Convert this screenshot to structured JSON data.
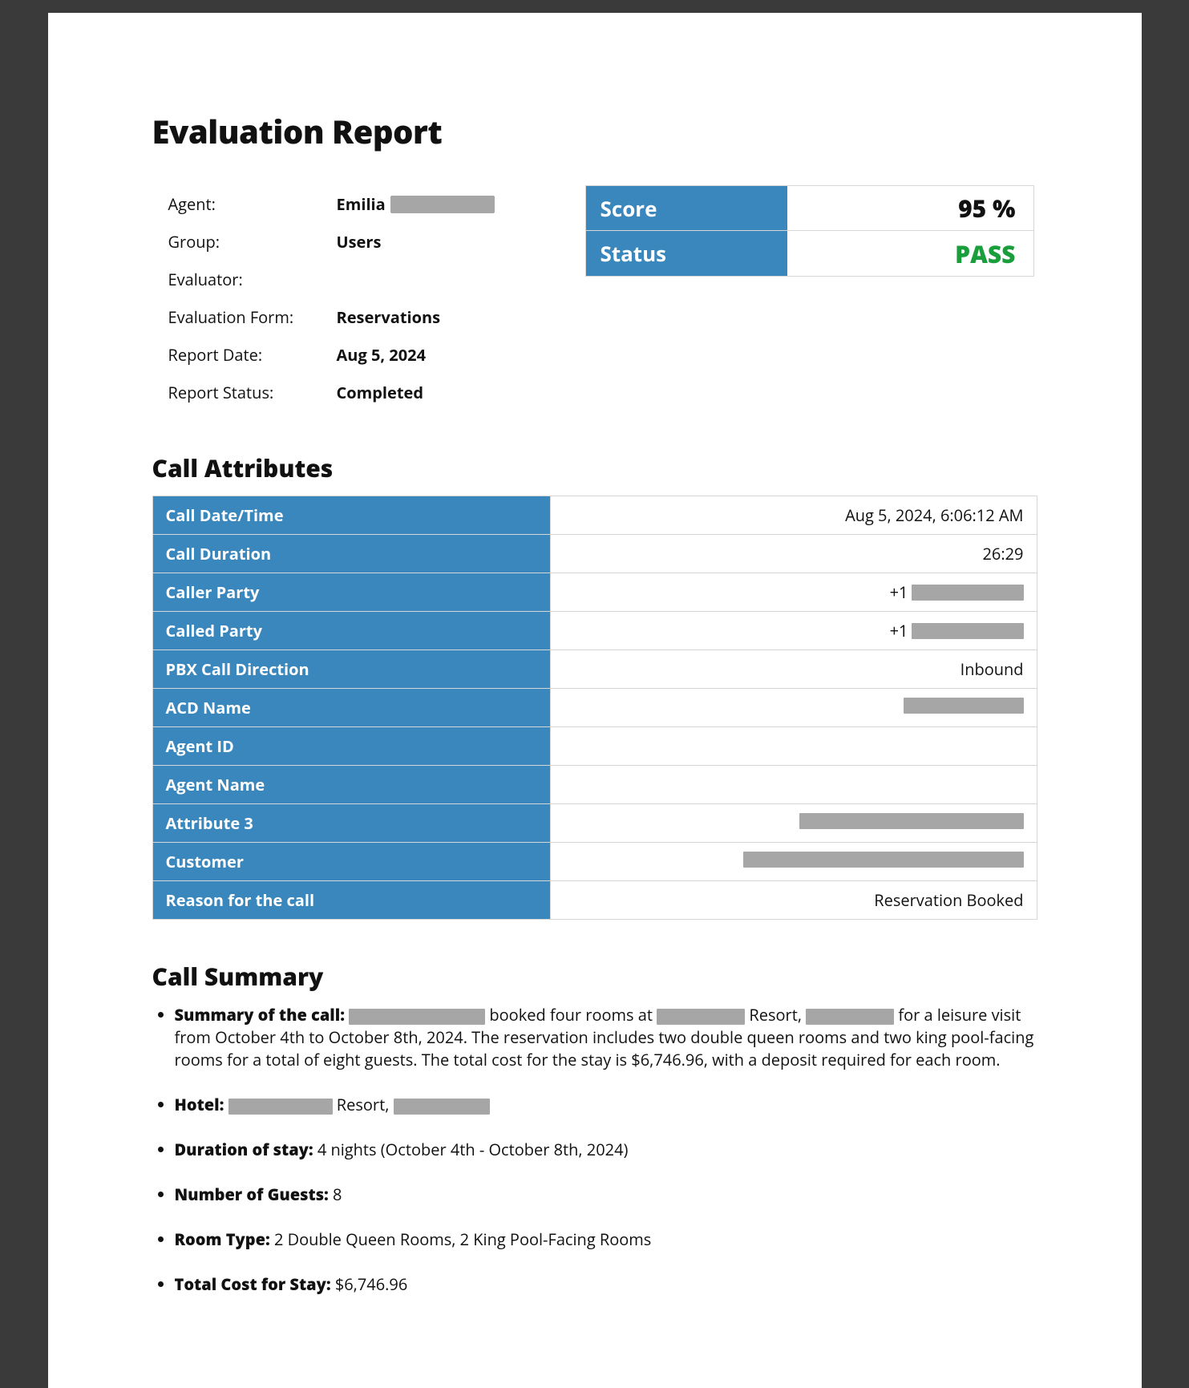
{
  "title": "Evaluation Report",
  "meta": {
    "agent_label": "Agent:",
    "agent_value": "Emilia",
    "group_label": "Group:",
    "group_value": "Users",
    "evaluator_label": "Evaluator:",
    "evaluator_value": "",
    "form_label": "Evaluation Form:",
    "form_value": "Reservations",
    "date_label": "Report Date:",
    "date_value": "Aug 5, 2024",
    "status_label": "Report Status:",
    "status_value": "Completed"
  },
  "score_card": {
    "score_label": "Score",
    "score_value": "95 %",
    "status_label": "Status",
    "status_value": "PASS"
  },
  "call_attributes": {
    "heading": "Call Attributes",
    "rows": [
      {
        "label": "Call Date/Time",
        "value": "Aug 5, 2024, 6:06:12 AM",
        "redact_w": 0,
        "prefix": ""
      },
      {
        "label": "Call Duration",
        "value": "26:29",
        "redact_w": 0,
        "prefix": ""
      },
      {
        "label": "Caller Party",
        "value": "",
        "prefix": "+1",
        "redact_w": 140
      },
      {
        "label": "Called Party",
        "value": "",
        "prefix": "+1",
        "redact_w": 140
      },
      {
        "label": "PBX Call Direction",
        "value": "Inbound",
        "redact_w": 0,
        "prefix": ""
      },
      {
        "label": "ACD Name",
        "value": "",
        "prefix": "",
        "redact_w": 150
      },
      {
        "label": "Agent ID",
        "value": "",
        "prefix": "",
        "redact_w": 0
      },
      {
        "label": "Agent Name",
        "value": "",
        "prefix": "",
        "redact_w": 0
      },
      {
        "label": "Attribute 3",
        "value": "",
        "prefix": "",
        "redact_w": 280
      },
      {
        "label": "Customer",
        "value": "",
        "prefix": "",
        "redact_w": 350
      },
      {
        "label": "Reason for the call",
        "value": "Reservation Booked",
        "prefix": "",
        "redact_w": 0
      }
    ]
  },
  "call_summary": {
    "heading": "Call Summary",
    "summary_bold": "Summary of the call:",
    "summary_text_1": " booked four rooms at ",
    "summary_text_2": " Resort, ",
    "summary_text_3": " for a leisure visit from October 4th to October 8th, 2024. The reservation includes two double queen rooms and two king pool-facing rooms for a total of eight guests. The total cost for the stay is $6,746.96, with a deposit required for each room.",
    "hotel_bold": "Hotel:",
    "hotel_text_1": " Resort, ",
    "duration_bold": "Duration of stay:",
    "duration_value": "4 nights (October 4th - October 8th, 2024)",
    "guests_bold": "Number of Guests:",
    "guests_value": "8",
    "room_bold": "Room Type:",
    "room_value": "2 Double Queen Rooms, 2 King Pool-Facing Rooms",
    "cost_bold": "Total Cost for Stay:",
    "cost_value": "$6,746.96"
  }
}
